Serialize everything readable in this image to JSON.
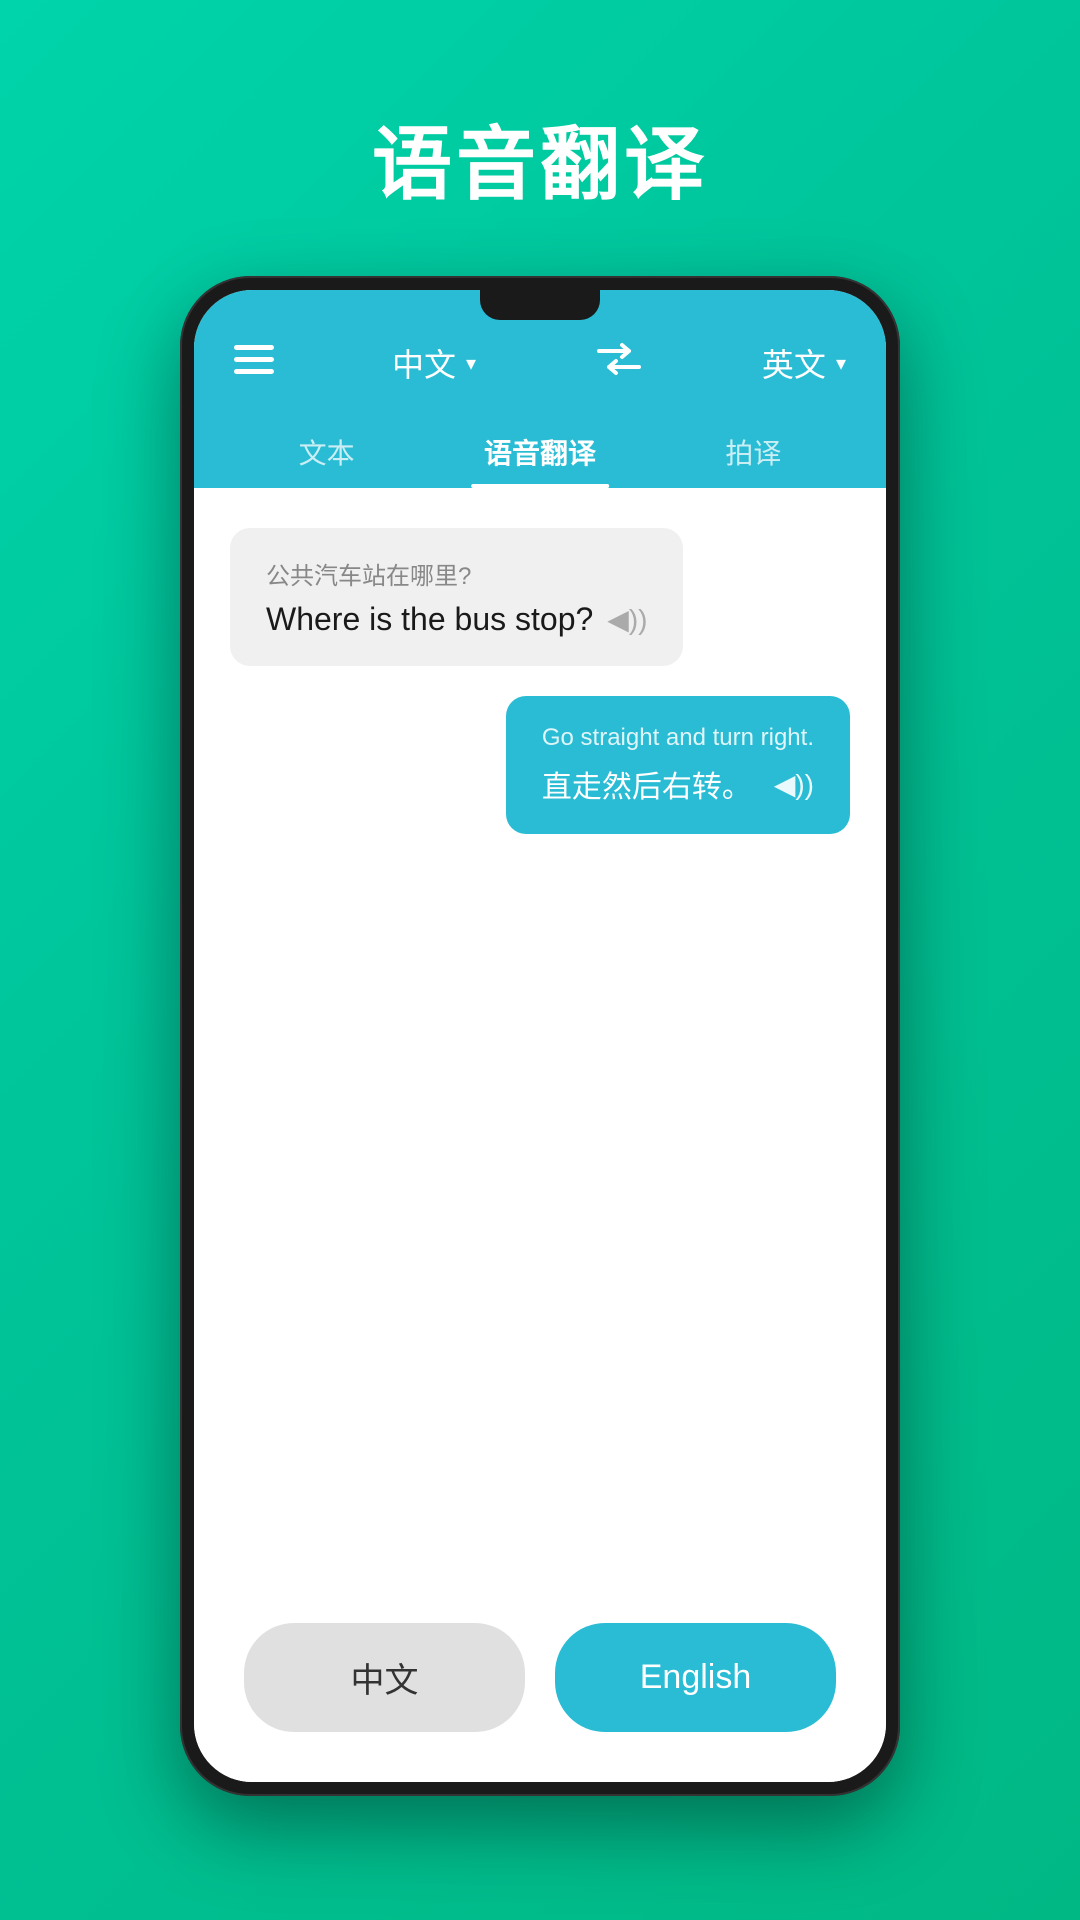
{
  "background": {
    "gradient_start": "#00d4aa",
    "gradient_end": "#00b884"
  },
  "page_title": "语音翻译",
  "header": {
    "source_lang": "中文",
    "target_lang": "英文",
    "menu_icon": "≡",
    "swap_icon": "⇄"
  },
  "tabs": [
    {
      "label": "文本",
      "active": false
    },
    {
      "label": "语音翻译",
      "active": true
    },
    {
      "label": "拍译",
      "active": false
    }
  ],
  "messages": [
    {
      "direction": "left",
      "original": "公共汽车站在哪里?",
      "translated": "Where is the bus stop?",
      "speaker": "◀))"
    },
    {
      "direction": "right",
      "original": "Go straight and turn right.",
      "translated": "直走然后右转。",
      "speaker": "◀))"
    }
  ],
  "bottom_buttons": [
    {
      "label": "中文",
      "type": "chinese"
    },
    {
      "label": "English",
      "type": "english"
    }
  ]
}
